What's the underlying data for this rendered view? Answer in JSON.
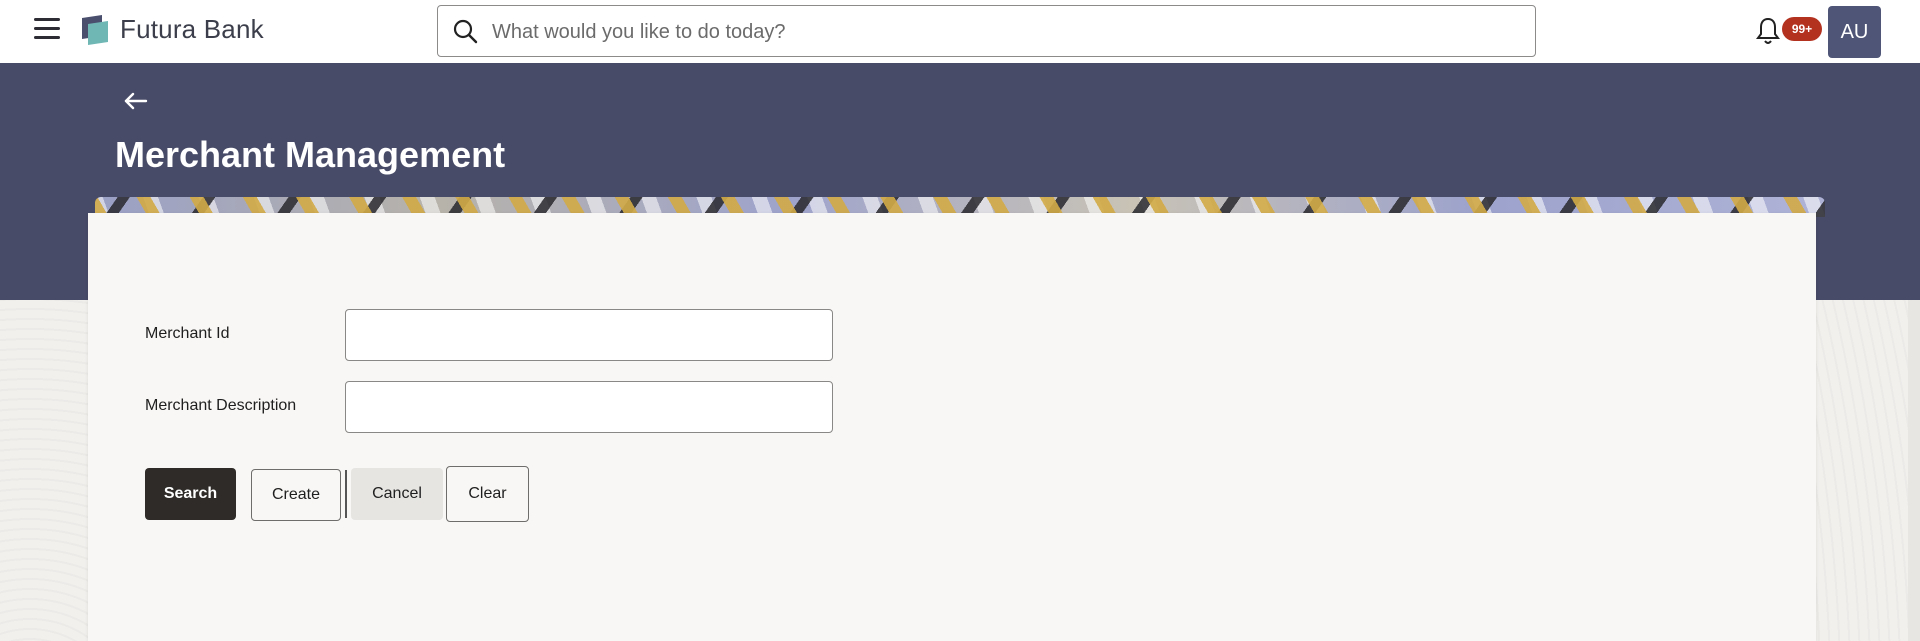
{
  "header": {
    "brand": "Futura Bank",
    "search_placeholder": "What would you like to do today?",
    "notification_count": "99+",
    "avatar_initials": "AU"
  },
  "page": {
    "title": "Merchant Management"
  },
  "form": {
    "merchant_id_label": "Merchant Id",
    "merchant_id_value": "",
    "merchant_description_label": "Merchant Description",
    "merchant_description_value": ""
  },
  "actions": {
    "search_label": "Search",
    "create_label": "Create",
    "cancel_label": "Cancel",
    "clear_label": "Clear"
  },
  "colors": {
    "banner": "#484b68",
    "primary_button": "#2e2b28",
    "badge": "#b3311f",
    "avatar": "#4e5577"
  }
}
